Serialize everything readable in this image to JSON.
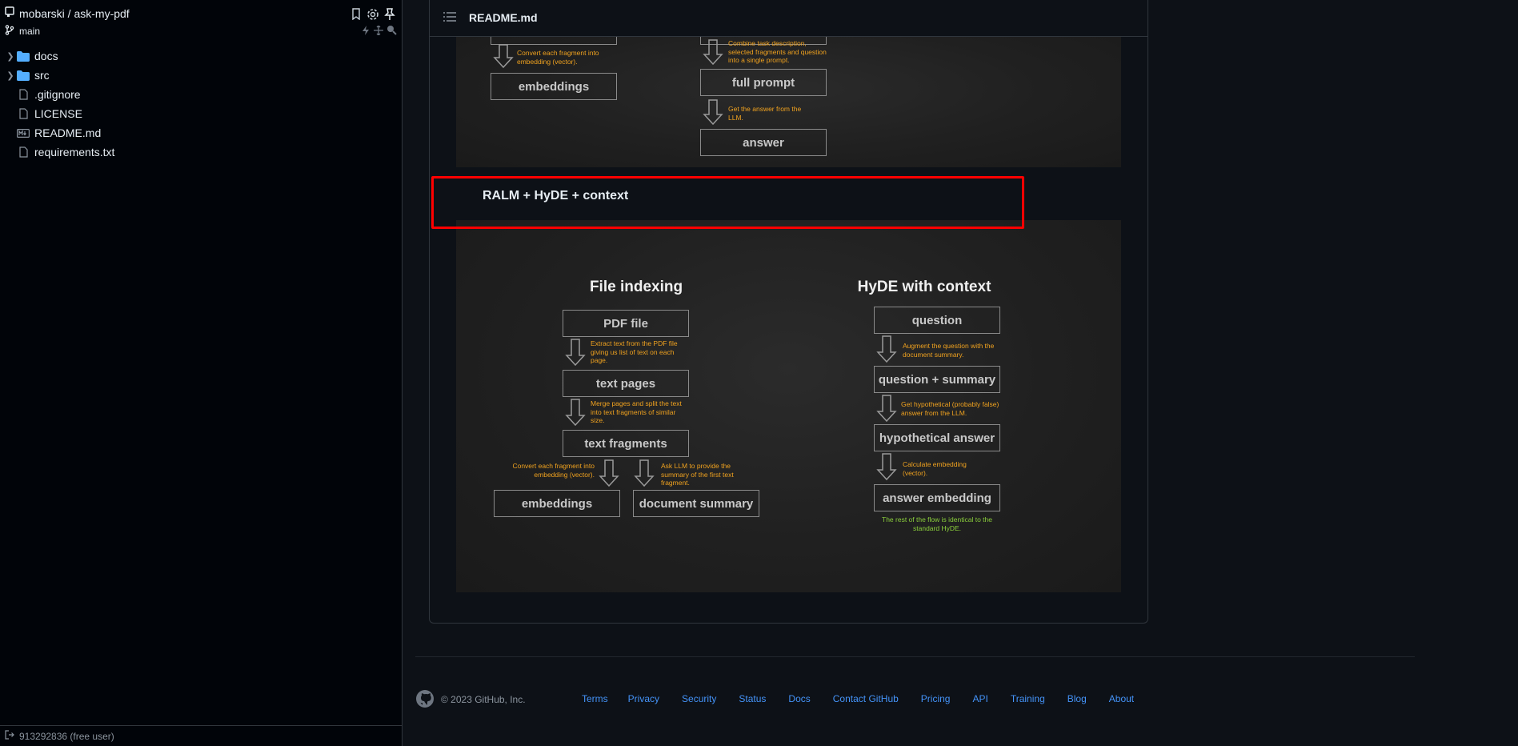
{
  "sidebar": {
    "repo": "mobarski / ask-my-pdf",
    "branch": "main",
    "items": [
      {
        "label": "docs",
        "type": "folder"
      },
      {
        "label": "src",
        "type": "folder"
      },
      {
        "label": ".gitignore",
        "type": "file"
      },
      {
        "label": "LICENSE",
        "type": "file"
      },
      {
        "label": "README.md",
        "type": "markdown"
      },
      {
        "label": "requirements.txt",
        "type": "file"
      }
    ],
    "footer_user": "913292836 (free user)"
  },
  "readme": {
    "filename": "README.md",
    "section_title": "RALM + HyDE + context"
  },
  "top_diagram": {
    "left_note": "Convert each fragment into embedding (vector).",
    "left_box": "embeddings",
    "right_note1": "Combine task description, selected fragments and question into a single prompt.",
    "right_box1": "full prompt",
    "right_note2": "Get the answer from the LLM.",
    "right_box2": "answer"
  },
  "main_diagram": {
    "left_title": "File indexing",
    "left_boxes": [
      "PDF file",
      "text pages",
      "text fragments",
      "embeddings",
      "document summary"
    ],
    "left_notes": [
      "Extract text from the PDF file giving us list of text on each page.",
      "Merge pages and split the text into text fragments of similar size.",
      "Convert each fragment into embedding (vector).",
      "Ask LLM to provide the summary of the first text fragment."
    ],
    "right_title": "HyDE with context",
    "right_boxes": [
      "question",
      "question + summary",
      "hypothetical answer",
      "answer embedding"
    ],
    "right_notes": [
      "Augment the question with the document summary.",
      "Get hypothetical (probably false) answer from the LLM.",
      "Calculate embedding (vector)."
    ],
    "final_note": "The rest of the flow is identical to the standard HyDE."
  },
  "footer": {
    "copyright": "© 2023 GitHub, Inc.",
    "links": [
      "Terms",
      "Privacy",
      "Security",
      "Status",
      "Docs",
      "Contact GitHub",
      "Pricing",
      "API",
      "Training",
      "Blog",
      "About"
    ]
  },
  "colors": {
    "note_orange": "#f0a21f",
    "note_green": "#8bcf3c",
    "highlight_red": "#ff0000",
    "link_blue": "#4493f8"
  }
}
